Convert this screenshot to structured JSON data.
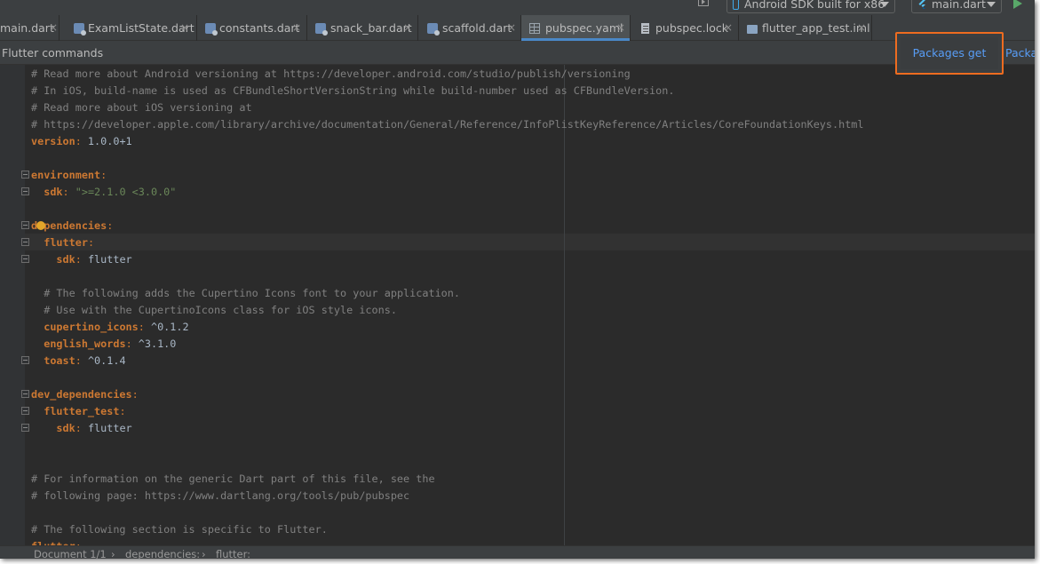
{
  "toolbar": {
    "device_label": "Android SDK built for x86",
    "config_label": "main.dart"
  },
  "tabs": [
    {
      "label": "main.dart",
      "icon": "dart-file-icon",
      "active": false
    },
    {
      "label": "ExamListState.dart",
      "icon": "dart-file-icon",
      "active": false
    },
    {
      "label": "constants.dart",
      "icon": "dart-file-icon",
      "active": false
    },
    {
      "label": "snack_bar.dart",
      "icon": "dart-file-icon",
      "active": false
    },
    {
      "label": "scaffold.dart",
      "icon": "dart-file-icon",
      "active": false
    },
    {
      "label": "pubspec.yaml",
      "icon": "yaml-file-icon",
      "active": true
    },
    {
      "label": "pubspec.lock",
      "icon": "file-icon",
      "active": false
    },
    {
      "label": "flutter_app_test.iml",
      "icon": "module-file-icon",
      "active": false
    }
  ],
  "tab_close_glyph": "×",
  "commands": {
    "title": "Flutter commands",
    "packages_get": "Packages get",
    "packages_upgrade": "Packages upgrade"
  },
  "code_lines": [
    "# Read more about Android versioning at https://developer.android.com/studio/publish/versioning",
    "# In iOS, build-name is used as CFBundleShortVersionString while build-number used as CFBundleVersion.",
    "# Read more about iOS versioning at",
    "# https://developer.apple.com/library/archive/documentation/General/Reference/InfoPlistKeyReference/Articles/CoreFoundationKeys.html",
    "version: 1.0.0+1",
    "",
    "environment:",
    "  sdk: \">=2.1.0 <3.0.0\"",
    "",
    "dependencies:",
    "  flutter:",
    "    sdk: flutter",
    "",
    "  # The following adds the Cupertino Icons font to your application.",
    "  # Use with the CupertinoIcons class for iOS style icons.",
    "  cupertino_icons: ^0.1.2",
    "  english_words: ^3.1.0",
    "  toast: ^0.1.4",
    "",
    "dev_dependencies:",
    "  flutter_test:",
    "    sdk: flutter",
    "",
    "",
    "# For information on the generic Dart part of this file, see the",
    "# following page: https://www.dartlang.org/tools/pub/pubspec",
    "",
    "# The following section is specific to Flutter.",
    "flutter:"
  ],
  "breadcrumbs": [
    "Document 1/1",
    "dependencies:",
    "flutter:"
  ],
  "breadcrumb_separator": "›",
  "colors": {
    "accent_highlight": "#ee6c20",
    "link_blue": "#589df6",
    "yaml_key": "#cc7832",
    "comment": "#808080",
    "string": "#6a8759"
  }
}
